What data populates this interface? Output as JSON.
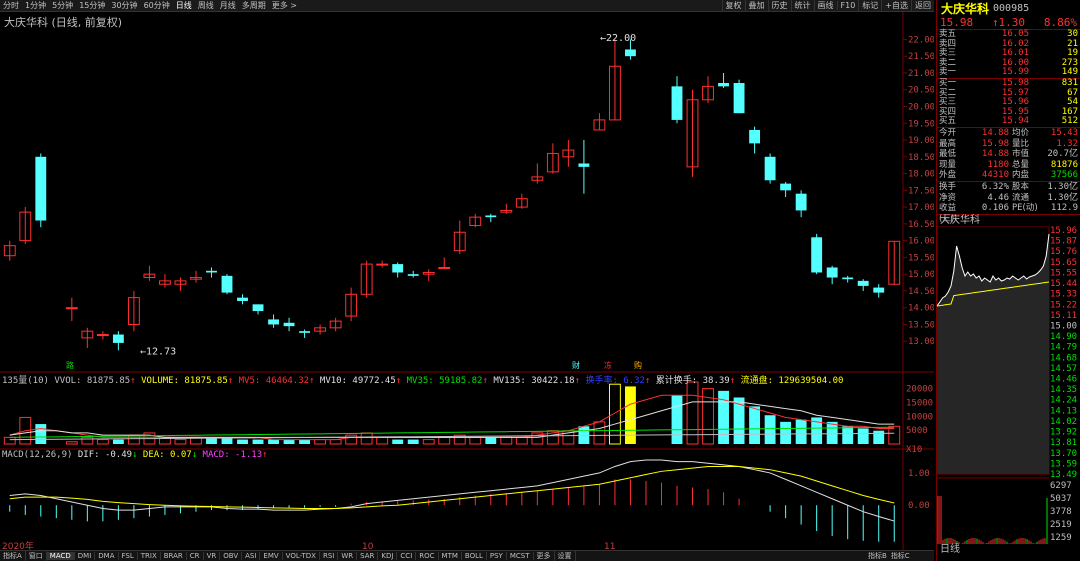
{
  "toolbar": {
    "periods": [
      "分时",
      "1分钟",
      "5分钟",
      "15分钟",
      "30分钟",
      "60分钟",
      "日线",
      "周线",
      "月线",
      "多周期",
      "更多 >"
    ],
    "active_period": "日线",
    "right_buttons": [
      "复权",
      "叠加",
      "历史",
      "统计",
      "画线",
      "F10",
      "标记",
      "+自选",
      "返回"
    ]
  },
  "chart": {
    "title": "大庆华科 (日线, 前复权)",
    "high_label": "22.00",
    "low_label": "12.73",
    "price_ticks": [
      "22.00",
      "21.50",
      "21.00",
      "20.50",
      "20.00",
      "19.50",
      "19.00",
      "18.50",
      "18.00",
      "17.50",
      "17.00",
      "16.50",
      "16.00",
      "15.50",
      "15.00",
      "14.50",
      "14.00",
      "13.50",
      "13.00"
    ],
    "event_markers": [
      "路",
      "财",
      "冻",
      "购"
    ],
    "date_labels": [
      "2020年",
      "10",
      "11"
    ]
  },
  "volume_legend": {
    "name": "135量(10)",
    "vvol": "VVOL: 81875.85",
    "volume": "VOLUME: 81875.85",
    "mv5": "MV5: 46464.32",
    "mv10": "MV10: 49772.45",
    "mv35": "MV35: 59185.82",
    "mv135": "MV135: 30422.18",
    "turnover": "换手率: 6.32",
    "cum_turnover": "累计换手: 38.39",
    "float_shares": "流通盘: 129639504.00",
    "ticks": [
      "20000",
      "15000",
      "10000",
      "5000"
    ],
    "unit": "X10"
  },
  "macd_legend": {
    "name": "MACD(12,26,9)",
    "dif": "DIF: -0.49",
    "dea": "DEA: 0.07",
    "macd": "MACD: -1.13",
    "ticks": [
      "1.00",
      "0.00"
    ]
  },
  "indicator_tabs": [
    "指标A",
    "窗口",
    "MACD",
    "DMI",
    "DMA",
    "FSL",
    "TRIX",
    "BRAR",
    "CR",
    "VR",
    "OBV",
    "ASI",
    "EMV",
    "VOL-TDX",
    "RSI",
    "WR",
    "SAR",
    "KDJ",
    "CCI",
    "ROC",
    "MTM",
    "BOLL",
    "PSY",
    "MCST",
    "更多",
    "设置"
  ],
  "active_indicator": "MACD",
  "right_bottom_tabs": [
    "指标B",
    "指标C"
  ],
  "quote": {
    "name": "大庆华科",
    "code": "000985",
    "price": "15.98",
    "change": "↑1.30",
    "change_pct": "8.86%",
    "asks": [
      {
        "label": "卖五",
        "price": "16.05",
        "vol": "30"
      },
      {
        "label": "卖四",
        "price": "16.02",
        "vol": "21"
      },
      {
        "label": "卖三",
        "price": "16.01",
        "vol": "19"
      },
      {
        "label": "卖二",
        "price": "16.00",
        "vol": "273"
      },
      {
        "label": "卖一",
        "price": "15.99",
        "vol": "149"
      }
    ],
    "bids": [
      {
        "label": "买一",
        "price": "15.98",
        "vol": "831"
      },
      {
        "label": "买二",
        "price": "15.97",
        "vol": "67"
      },
      {
        "label": "买三",
        "price": "15.96",
        "vol": "54"
      },
      {
        "label": "买四",
        "price": "15.95",
        "vol": "167"
      },
      {
        "label": "买五",
        "price": "15.94",
        "vol": "512"
      }
    ],
    "stats1": [
      {
        "l": "今开",
        "v": "14.88",
        "vc": "#ff3030",
        "l2": "均价",
        "v2": "15.43",
        "v2c": "#ff3030"
      },
      {
        "l": "最高",
        "v": "15.98",
        "vc": "#ff3030",
        "l2": "量比",
        "v2": "1.32",
        "v2c": "#ff3030"
      },
      {
        "l": "最低",
        "v": "14.88",
        "vc": "#ff3030",
        "l2": "市值",
        "v2": "20.7亿",
        "v2c": "#c0c0c0"
      },
      {
        "l": "现量",
        "v": "1180",
        "vc": "#ff3030",
        "l2": "总量",
        "v2": "81876",
        "v2c": "#ffff00"
      },
      {
        "l": "外盘",
        "v": "44310",
        "vc": "#ff3030",
        "l2": "内盘",
        "v2": "37566",
        "v2c": "#00e000"
      }
    ],
    "stats2": [
      {
        "l": "换手",
        "v": "6.32%",
        "vc": "#c0c0c0",
        "l2": "股本",
        "v2": "1.30亿",
        "v2c": "#c0c0c0"
      },
      {
        "l": "净资",
        "v": "4.46",
        "vc": "#c0c0c0",
        "l2": "流通",
        "v2": "1.30亿",
        "v2c": "#c0c0c0"
      },
      {
        "l": "收益(三)",
        "v": "0.106",
        "vc": "#c0c0c0",
        "l2": "PE(动)",
        "v2": "112.9",
        "v2c": "#c0c0c0"
      }
    ]
  },
  "mini_chart": {
    "title": "大庆华科",
    "bottom_label": "日线",
    "price_ticks": [
      "15.96",
      "15.87",
      "15.76",
      "15.65",
      "15.55",
      "15.44",
      "15.33",
      "15.22",
      "15.11",
      "15.00",
      "14.90",
      "14.79",
      "14.68",
      "14.57",
      "14.46",
      "14.35",
      "14.24",
      "14.13",
      "14.02",
      "13.92",
      "13.81",
      "13.70",
      "13.59",
      "13.49"
    ],
    "vol_ticks": [
      "6297",
      "5037",
      "3778",
      "2519",
      "1259"
    ]
  }
}
